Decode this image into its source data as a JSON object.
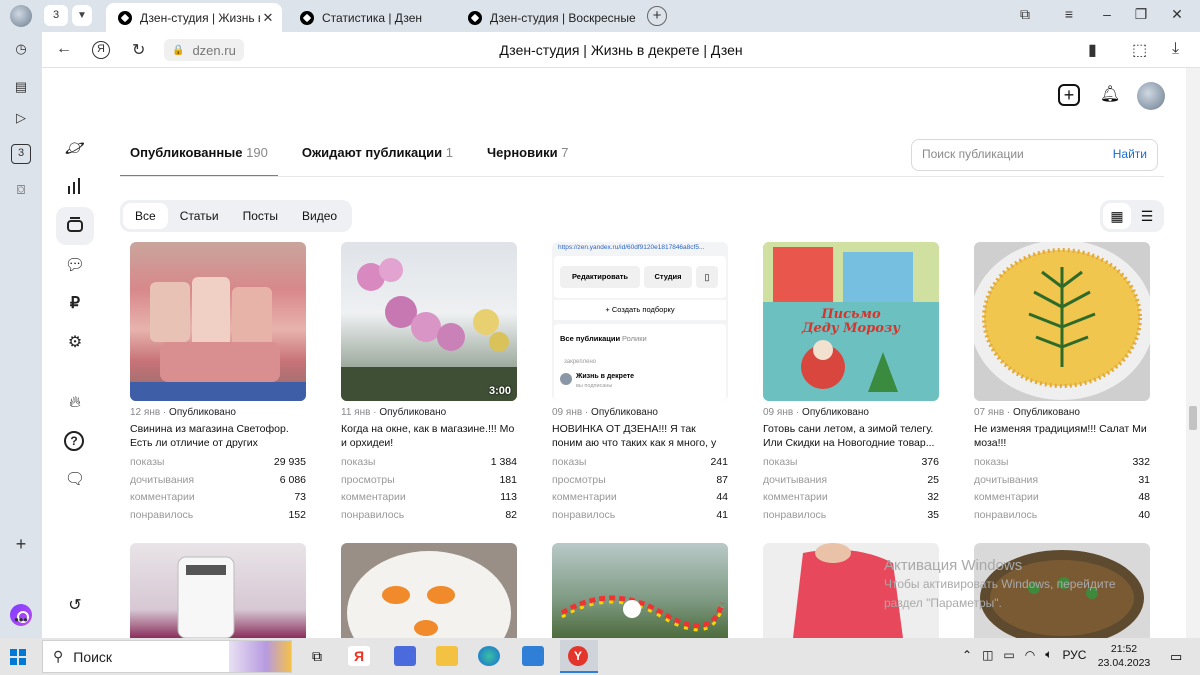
{
  "browser": {
    "tab_count": "3",
    "tabs": [
      {
        "title": "Дзен-студия | Жизнь в д"
      },
      {
        "title": "Статистика | Дзен"
      },
      {
        "title": "Дзен-студия | Воскресные"
      }
    ],
    "url": "dzen.ru",
    "page_title": "Дзен-студия | Жизнь в декрете | Дзен",
    "sidebar_badge": "3"
  },
  "studio": {
    "tabs": [
      {
        "label": "Опубликованные",
        "count": "190"
      },
      {
        "label": "Ожидают публикации",
        "count": "1"
      },
      {
        "label": "Черновики",
        "count": "7"
      }
    ],
    "search": {
      "placeholder": "Поиск публикации",
      "button": "Найти"
    },
    "filters": [
      "Все",
      "Статьи",
      "Посты",
      "Видео"
    ]
  },
  "cards": [
    {
      "date": "12 янв",
      "status": "Опубликовано",
      "title": "Свинина из магазина Светофор. Есть ли отличие от других магазинов.",
      "stats": [
        {
          "label": "показы",
          "value": "29 935"
        },
        {
          "label": "дочитывания",
          "value": "6 086"
        },
        {
          "label": "комментарии",
          "value": "73"
        },
        {
          "label": "понравилось",
          "value": "152"
        }
      ]
    },
    {
      "date": "11 янв",
      "status": "Опубликовано",
      "title": "Когда на окне, как в магазине.!!! Мо и орхидеи!",
      "duration": "3:00",
      "stats": [
        {
          "label": "показы",
          "value": "1 384"
        },
        {
          "label": "просмотры",
          "value": "181"
        },
        {
          "label": "комментарии",
          "value": "113"
        },
        {
          "label": "понравилось",
          "value": "82"
        }
      ]
    },
    {
      "date": "09 янв",
      "status": "Опубликовано",
      "title": "НОВИНКА ОТ ДЗЕНА!!! Я так поним аю что таких как я много, у кого с...",
      "stats": [
        {
          "label": "показы",
          "value": "241"
        },
        {
          "label": "просмотры",
          "value": "87"
        },
        {
          "label": "комментарии",
          "value": "44"
        },
        {
          "label": "понравилось",
          "value": "41"
        }
      ]
    },
    {
      "date": "09 янв",
      "status": "Опубликовано",
      "title": "Готовь сани летом, а зимой телегу. Или Скидки на Новогодние товар...",
      "stats": [
        {
          "label": "показы",
          "value": "376"
        },
        {
          "label": "дочитывания",
          "value": "25"
        },
        {
          "label": "комментарии",
          "value": "32"
        },
        {
          "label": "понравилось",
          "value": "35"
        }
      ]
    },
    {
      "date": "07 янв",
      "status": "Опубликовано",
      "title": "Не изменяя традициям!!! Салат Ми моза!!!",
      "stats": [
        {
          "label": "показы",
          "value": "332"
        },
        {
          "label": "дочитывания",
          "value": "31"
        },
        {
          "label": "комментарии",
          "value": "48"
        },
        {
          "label": "понравилось",
          "value": "40"
        }
      ]
    }
  ],
  "screenshot_inner": {
    "url": "https://zen.yandex.ru/id/60df9120e1817846a8cf5...",
    "edit": "Редактировать",
    "studio": "Студия",
    "create": "Создать подборку",
    "all_pubs": "Все публикации",
    "rolls": "Ролики",
    "pinned": "закреплено",
    "channel": "Жизнь в декрете",
    "subscribed": "вы подписаны"
  },
  "book_cover": {
    "line1": "Письмо",
    "line2": "Деду Морозу"
  },
  "watermark": {
    "line1": "Активация Windows",
    "line2": "Чтобы активировать Windows, перейдите",
    "line3": "раздел \"Параметры\"."
  },
  "taskbar": {
    "search_label": "Поиск",
    "lang": "РУС",
    "time": "21:52",
    "date": "23.04.2023"
  }
}
